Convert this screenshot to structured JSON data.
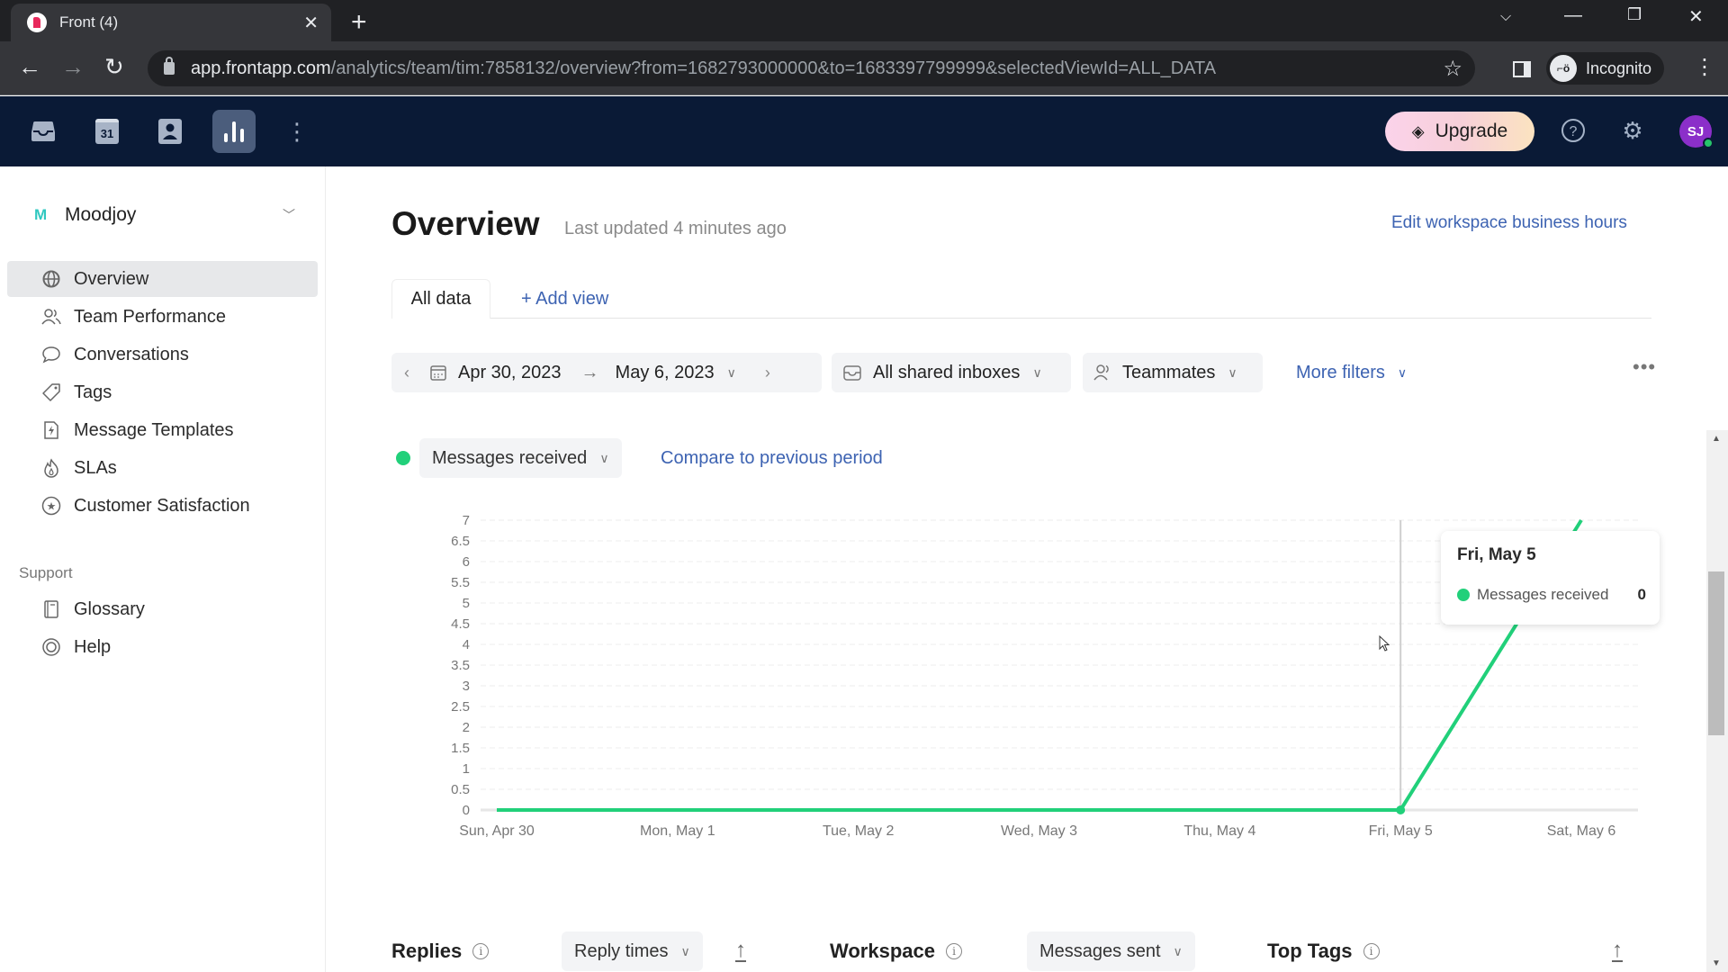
{
  "browser": {
    "tab_title": "Front (4)",
    "url_host": "app.frontapp.com",
    "url_path": "/analytics/team/tim:7858132/overview?from=1682793000000&to=1683397799999&selectedViewId=ALL_DATA",
    "profile_label": "Incognito"
  },
  "header": {
    "upgrade_label": "Upgrade",
    "avatar_initials": "SJ",
    "calendar_day": "31"
  },
  "sidebar": {
    "workspace_initial": "M",
    "workspace_name": "Moodjoy",
    "items": [
      {
        "label": "Overview",
        "icon": "globe-icon",
        "active": true
      },
      {
        "label": "Team Performance",
        "icon": "people-icon"
      },
      {
        "label": "Conversations",
        "icon": "chat-bubble-icon"
      },
      {
        "label": "Tags",
        "icon": "tag-icon"
      },
      {
        "label": "Message Templates",
        "icon": "lightning-doc-icon"
      },
      {
        "label": "SLAs",
        "icon": "flame-icon"
      },
      {
        "label": "Customer Satisfaction",
        "icon": "star-badge-icon"
      }
    ],
    "support_label": "Support",
    "support_items": [
      {
        "label": "Glossary",
        "icon": "book-icon"
      },
      {
        "label": "Help",
        "icon": "lifebuoy-icon"
      }
    ]
  },
  "main": {
    "title": "Overview",
    "last_updated": "Last updated 4 minutes ago",
    "edit_hours_link": "Edit workspace business hours",
    "tabs": [
      {
        "label": "All data",
        "active": true
      },
      {
        "label": "+ Add view"
      }
    ],
    "filters": {
      "date_from": "Apr 30, 2023",
      "date_to": "May 6, 2023",
      "inbox": "All shared inboxes",
      "teammates": "Teammates",
      "more_filters": "More filters"
    },
    "metric_select": "Messages received",
    "compare_link": "Compare to previous period",
    "tooltip": {
      "title": "Fri, May 5",
      "series": "Messages received",
      "value": "0"
    },
    "bottom_sections": [
      {
        "title": "Replies",
        "select": "Reply times"
      },
      {
        "title": "Workspace",
        "select": "Messages sent"
      },
      {
        "title": "Top Tags"
      }
    ]
  },
  "colors": {
    "series": "#21d07a",
    "link": "#3d63b2",
    "app_header": "#0a1a36"
  },
  "chart_data": {
    "type": "line",
    "title": "",
    "xlabel": "",
    "ylabel": "",
    "categories": [
      "Sun, Apr 30",
      "Mon, May 1",
      "Tue, May 2",
      "Wed, May 3",
      "Thu, May 4",
      "Fri, May 5",
      "Sat, May 6"
    ],
    "series": [
      {
        "name": "Messages received",
        "values": [
          0,
          0,
          0,
          0,
          0,
          0,
          7
        ]
      }
    ],
    "ylim": [
      0,
      7
    ],
    "yticks": [
      0,
      0.5,
      1,
      1.5,
      2,
      2.5,
      3,
      3.5,
      4,
      4.5,
      5,
      5.5,
      6,
      6.5,
      7
    ],
    "grid": true,
    "highlighted_category": "Fri, May 5"
  }
}
